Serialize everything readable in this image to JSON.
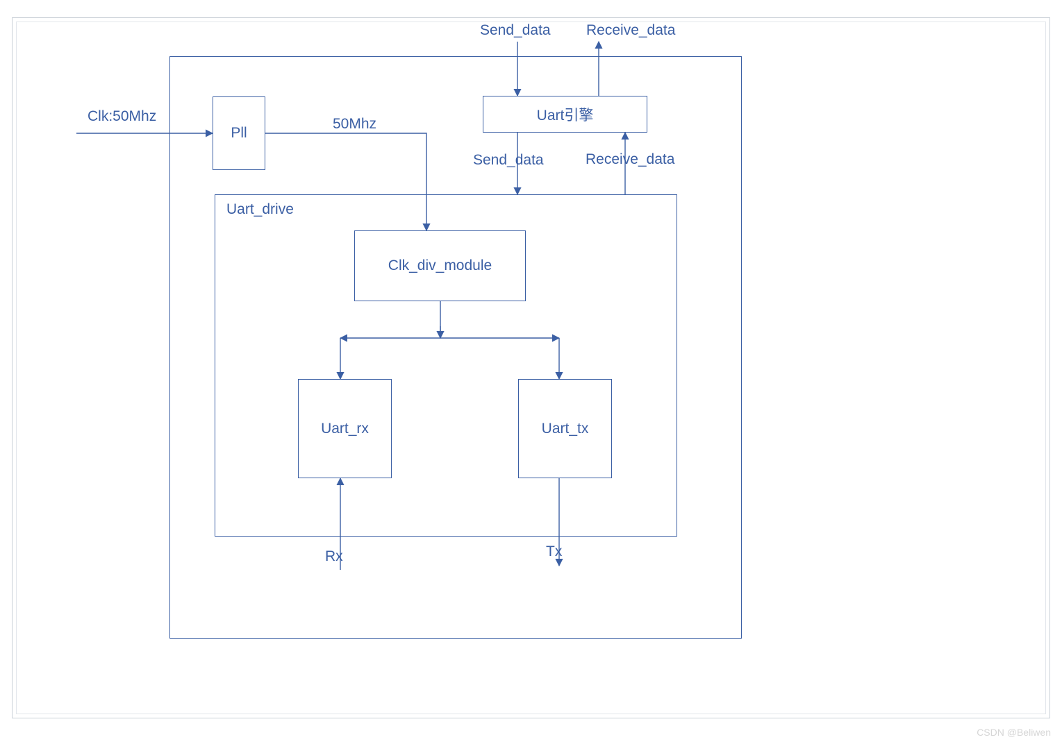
{
  "external": {
    "clk_label": "Clk:50Mhz",
    "send_data_top": "Send_data",
    "receive_data_top": "Receive_data",
    "rx_label": "Rx",
    "tx_label": "Tx"
  },
  "blocks": {
    "pll": "Pll",
    "pll_out_label": "50Mhz",
    "uart_engine": "Uart引擎",
    "send_data_mid": "Send_data",
    "receive_data_mid": "Receive_data",
    "uart_drive": "Uart_drive",
    "clk_div": "Clk_div_module",
    "uart_rx": "Uart_rx",
    "uart_tx": "Uart_tx"
  },
  "meta": {
    "watermark": "CSDN @Beliwen"
  },
  "colors": {
    "line": "#3b5fa4",
    "text": "#3b5fa4",
    "bg": "#ffffff"
  }
}
